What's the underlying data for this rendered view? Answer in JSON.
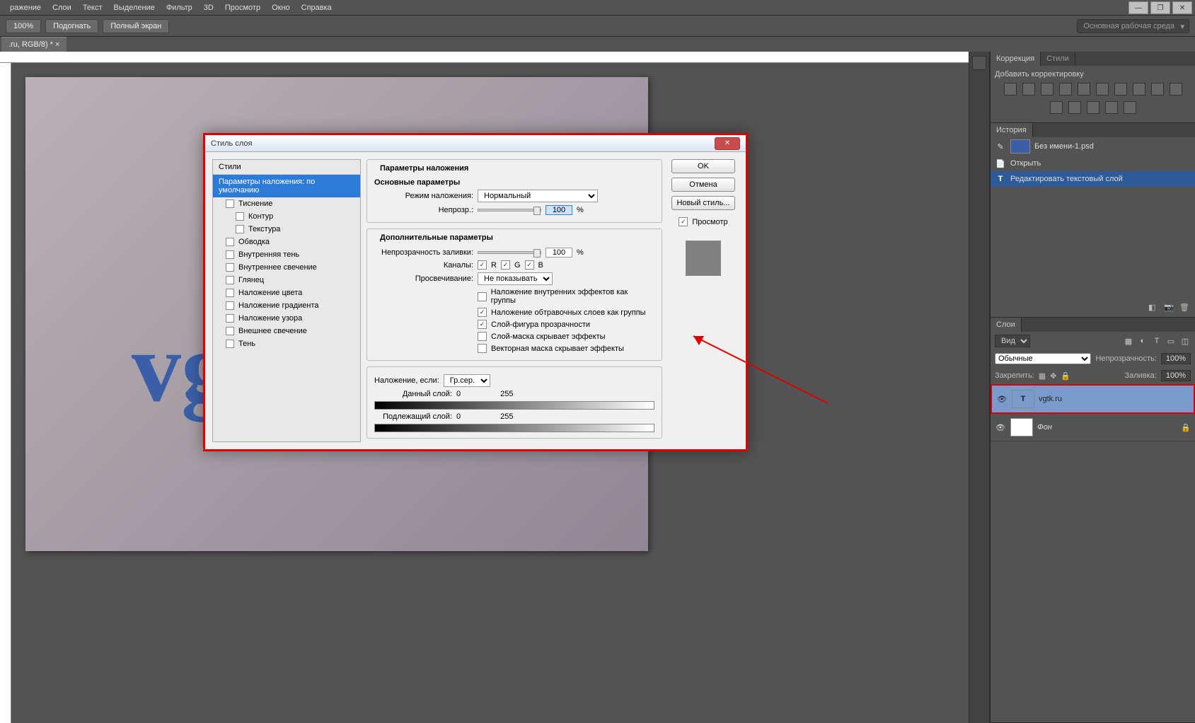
{
  "menubar": [
    "ражение",
    "Слои",
    "Текст",
    "Выделение",
    "Фильтр",
    "3D",
    "Просмотр",
    "Окно",
    "Справка"
  ],
  "optionsbar": {
    "zoom": "100%",
    "fit": "Подогнать",
    "full": "Полный экран",
    "workspace": "Основная рабочая среда"
  },
  "doctab": ".ru, RGB/8) *",
  "canvas_text": "vg",
  "dialog": {
    "title": "Стиль слоя",
    "styles_header": "Стили",
    "selected_style": "Параметры наложения: по умолчанию",
    "style_items": [
      "Тиснение",
      "Контур",
      "Текстура",
      "Обводка",
      "Внутренняя тень",
      "Внутреннее свечение",
      "Глянец",
      "Наложение цвета",
      "Наложение градиента",
      "Наложение узора",
      "Внешнее свечение",
      "Тень"
    ],
    "params": {
      "main_legend": "Параметры наложения",
      "basic_legend": "Основные параметры",
      "blend_mode_label": "Режим наложения:",
      "blend_mode_value": "Нормальный",
      "opacity_label": "Непрозр.:",
      "opacity_value": "100",
      "pct": "%",
      "advanced_legend": "Дополнительные параметры",
      "fill_opacity_label": "Непрозрачность заливки:",
      "fill_opacity_value": "100",
      "channels_label": "Каналы:",
      "ch_r": "R",
      "ch_g": "G",
      "ch_b": "B",
      "knockout_label": "Просвечивание:",
      "knockout_value": "Не показывать",
      "cb1": "Наложение внутренних эффектов как группы",
      "cb2": "Наложение обтравочных слоев как группы",
      "cb3": "Слой-фигура прозрачности",
      "cb4": "Слой-маска скрывает эффекты",
      "cb5": "Векторная маска скрывает эффекты",
      "blendif_label": "Наложение, если:",
      "blendif_value": "Гр.сер.",
      "this_layer_label": "Данный слой:",
      "underlying_label": "Подлежащий слой:",
      "range_min": "0",
      "range_max": "255"
    },
    "buttons": {
      "ok": "OK",
      "cancel": "Отмена",
      "newstyle": "Новый стиль...",
      "preview": "Просмотр"
    }
  },
  "panels": {
    "correction_tab": "Коррекция",
    "styles_tab": "Стили",
    "add_correction": "Добавить корректировку",
    "history_tab": "История",
    "history_doc": "Без имени-1.psd",
    "history_items": [
      {
        "icon": "open",
        "label": "Открыть"
      },
      {
        "icon": "text",
        "label": "Редактировать текстовый слой"
      }
    ],
    "layers_tab": "Слои",
    "layer_kind": "Вид",
    "blend_mode": "Обычные",
    "opacity_label": "Непрозрачность:",
    "opacity_value": "100%",
    "lock_label": "Закрепить:",
    "fill_label": "Заливка:",
    "fill_value": "100%",
    "layers": [
      {
        "name": "vgtk.ru",
        "type": "text",
        "selected": true
      },
      {
        "name": "Фон",
        "type": "bg",
        "locked": true
      }
    ]
  }
}
